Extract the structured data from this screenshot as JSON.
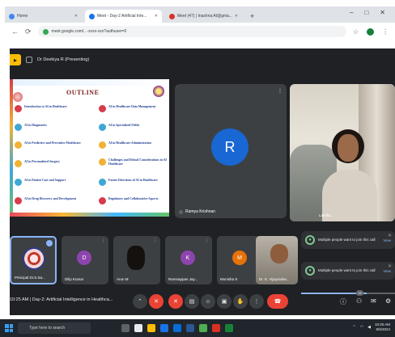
{
  "browser": {
    "tabs": [
      {
        "label": "Home",
        "favicon": "home-icon",
        "active": false
      },
      {
        "label": "Meet - Day-2 Artificial Inte...",
        "favicon": "meet-icon",
        "active": true
      },
      {
        "label": "Meet (47) | Inashna AI@gma...",
        "favicon": "mail-icon",
        "active": false
      }
    ],
    "new_tab": "+",
    "window_controls": [
      "–",
      "□",
      "✕"
    ],
    "url": "meet.google.com/...-xxxx-xxx?authuser=0"
  },
  "meet": {
    "presenting_label": "Dr Deekiya R (Presenting)",
    "slide": {
      "title": "OUTLINE",
      "items_left": [
        {
          "text": "Introduction to AI in Healthcare",
          "color": "#d73c4a"
        },
        {
          "text": "AI in Diagnostics",
          "color": "#3fa7d6"
        },
        {
          "text": "AI in Predictive and Preventive Healthcare",
          "color": "#f2b134"
        },
        {
          "text": "AI in Personalized Surgery",
          "color": "#f2b134"
        },
        {
          "text": "AI in Patient Care and Support",
          "color": "#3fa7d6"
        },
        {
          "text": "AI in Drug Discovery and Development",
          "color": "#d73c4a"
        }
      ],
      "items_right": [
        {
          "text": "AI in Healthcare Data Management",
          "color": "#d73c4a"
        },
        {
          "text": "AI in Specialized Fields",
          "color": "#3fa7d6"
        },
        {
          "text": "AI in Healthcare Administration",
          "color": "#f2b134"
        },
        {
          "text": "Challenges and Ethical Considerations in AI Healthcare",
          "color": "#f2b134"
        },
        {
          "text": "Future Directions of AI in Healthcare",
          "color": "#3fa7d6"
        },
        {
          "text": "Regulatory and Collaborative Aspects",
          "color": "#d73c4a"
        }
      ]
    },
    "main_tiles": {
      "ramya": {
        "initial": "R",
        "name": "Ramya Krishnan",
        "avatar_color": "#1967d2"
      },
      "camera": {
        "name": "Lathika..."
      }
    },
    "strip": [
      {
        "name": "Principal Dr.S.Sa...",
        "kind": "logo"
      },
      {
        "name": "Dilip Kumar",
        "initial": "D",
        "color": "#8e44ad"
      },
      {
        "name": "Arun M",
        "kind": "dark-photo"
      },
      {
        "name": "Ramnappan Jay...",
        "initial": "K",
        "color": "#8e44ad"
      },
      {
        "name": "Monisha S",
        "initial": "M",
        "color": "#e8710a"
      },
      {
        "name": "Dr. K. Vijayaraha...",
        "kind": "photo"
      }
    ],
    "notifications": [
      {
        "text": "Multiple people want to join this call",
        "action": "View"
      },
      {
        "text": "Multiple people want to join this call",
        "action": "View"
      }
    ],
    "notification_progress": 0.7,
    "control_bar": {
      "meeting_info": "10:25 AM | Day-2: Artificial Intelligence in Healthca...",
      "participant_count": "15"
    }
  },
  "taskbar": {
    "search_placeholder": "Type here to search",
    "time": "10:25 AM",
    "date": "8/6/2024"
  }
}
